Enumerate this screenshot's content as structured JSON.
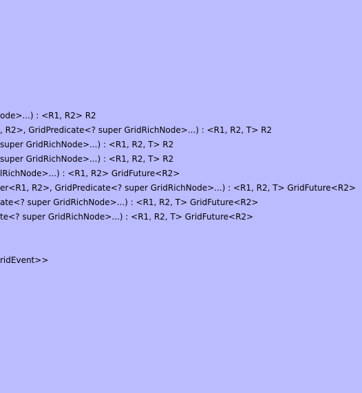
{
  "diagram": {
    "background_color": "#bbbbff",
    "text_color": "#000000",
    "methods": [
      "ode>...) : <R1, R2> R2",
      ", R2>, GridPredicate<? super GridRichNode>...) : <R1, R2, T> R2",
      " super GridRichNode>...) : <R1, R2, T> R2",
      "super GridRichNode>...) : <R1, R2, T> R2",
      "lRichNode>...) : <R1, R2> GridFuture<R2>",
      "er<R1, R2>, GridPredicate<? super GridRichNode>...) : <R1, R2, T> GridFuture<R2>",
      "ate<? super GridRichNode>...) : <R1, R2, T> GridFuture<R2>",
      "te<? super GridRichNode>...) : <R1, R2, T> GridFuture<R2>"
    ],
    "stereotype": "ridEvent>>"
  }
}
